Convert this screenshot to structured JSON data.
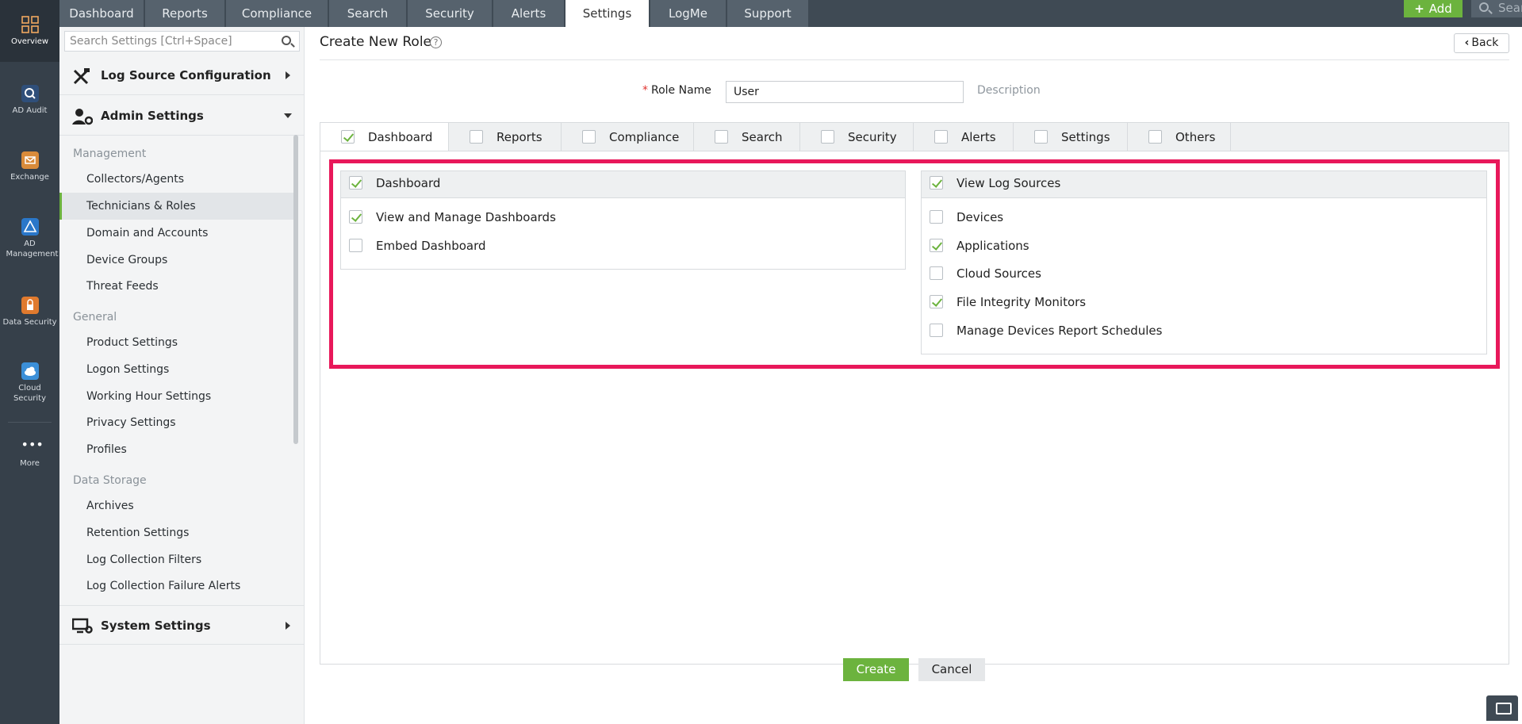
{
  "rail": {
    "items": [
      {
        "label": "Overview",
        "icon": "grid-icon"
      },
      {
        "label": "AD Audit",
        "icon": "ad-audit-icon"
      },
      {
        "label": "Exchange",
        "icon": "exchange-icon"
      },
      {
        "label": "AD Management",
        "icon": "ad-management-icon"
      },
      {
        "label": "Data Security",
        "icon": "data-security-icon"
      },
      {
        "label": "Cloud Security",
        "icon": "cloud-security-icon"
      },
      {
        "label": "More",
        "icon": "more-icon"
      }
    ]
  },
  "topnav": {
    "tabs": [
      "Dashboard",
      "Reports",
      "Compliance",
      "Search",
      "Security",
      "Alerts",
      "Settings",
      "LogMe",
      "Support"
    ],
    "active_tab": "Settings",
    "add_label": "Add",
    "search_placeholder": "Search"
  },
  "sidebar": {
    "search_placeholder": "Search Settings [Ctrl+Space]",
    "sections": [
      {
        "label": "Log Source Configuration",
        "state": "collapsed"
      },
      {
        "label": "Admin Settings",
        "state": "expanded"
      },
      {
        "label": "System Settings",
        "state": "collapsed"
      }
    ],
    "groups": [
      {
        "label": "Management",
        "items": [
          "Collectors/Agents",
          "Technicians & Roles",
          "Domain and Accounts",
          "Device Groups",
          "Threat Feeds"
        ]
      },
      {
        "label": "General",
        "items": [
          "Product Settings",
          "Logon Settings",
          "Working Hour Settings",
          "Privacy Settings",
          "Profiles"
        ]
      },
      {
        "label": "Data Storage",
        "items": [
          "Archives",
          "Retention Settings",
          "Log Collection Filters",
          "Log Collection Failure Alerts"
        ]
      }
    ],
    "active_item": "Technicians & Roles"
  },
  "main": {
    "title": "Create New Role",
    "back_label": "Back",
    "role_name_label": "Role Name",
    "role_name_value": "User",
    "description_link": "Description",
    "permission_tabs": [
      {
        "label": "Dashboard",
        "checked": true
      },
      {
        "label": "Reports",
        "checked": false
      },
      {
        "label": "Compliance",
        "checked": false
      },
      {
        "label": "Search",
        "checked": false
      },
      {
        "label": "Security",
        "checked": false
      },
      {
        "label": "Alerts",
        "checked": false
      },
      {
        "label": "Settings",
        "checked": false
      },
      {
        "label": "Others",
        "checked": false
      }
    ],
    "active_permission_tab": "Dashboard",
    "panels": [
      {
        "header": {
          "label": "Dashboard",
          "checked": true
        },
        "items": [
          {
            "label": "View and Manage Dashboards",
            "checked": true
          },
          {
            "label": "Embed Dashboard",
            "checked": false
          }
        ]
      },
      {
        "header": {
          "label": "View Log Sources",
          "checked": true
        },
        "items": [
          {
            "label": "Devices",
            "checked": false
          },
          {
            "label": "Applications",
            "checked": true
          },
          {
            "label": "Cloud Sources",
            "checked": false
          },
          {
            "label": "File Integrity Monitors",
            "checked": true
          },
          {
            "label": "Manage Devices Report Schedules",
            "checked": false
          }
        ]
      }
    ],
    "create_label": "Create",
    "cancel_label": "Cancel"
  },
  "colors": {
    "accent_green": "#6cb33e",
    "highlight_red": "#e8185a",
    "nav_dark": "#36404a"
  }
}
